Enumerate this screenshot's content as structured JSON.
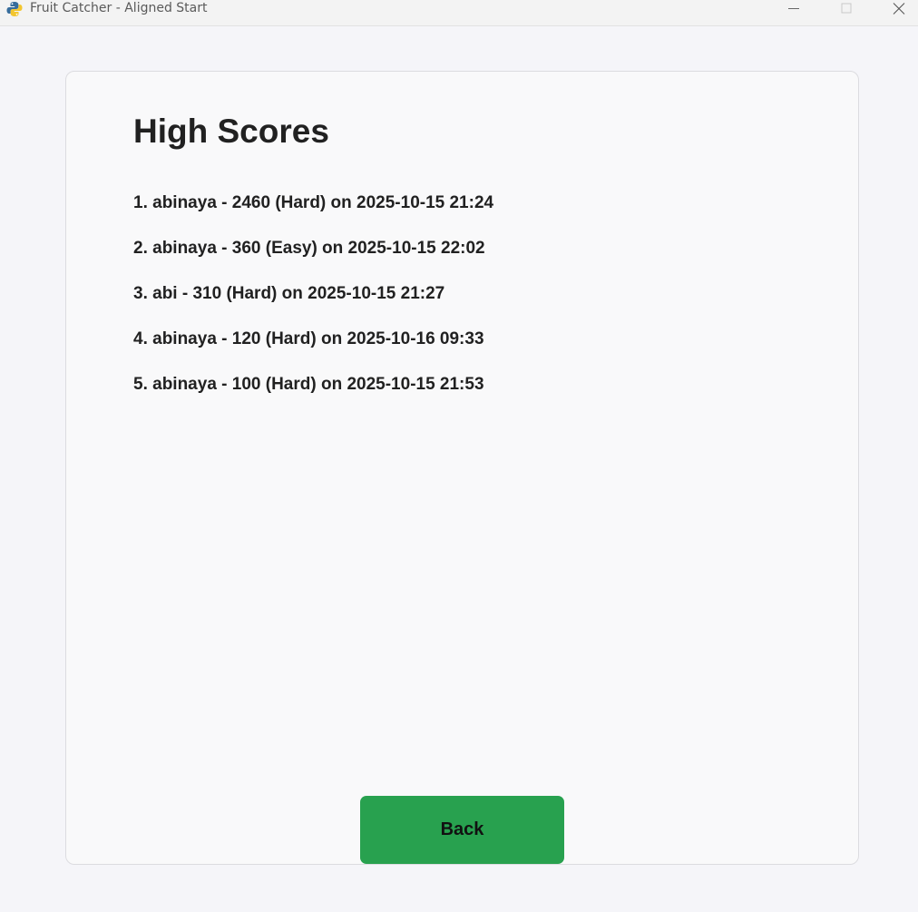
{
  "window": {
    "title": "Fruit Catcher - Aligned Start",
    "icon": "python-snake-icon"
  },
  "colors": {
    "card_background": "#f9f9fa",
    "page_background": "#f5f5f9",
    "back_button": "#28a14f",
    "text": "#212121"
  },
  "high_scores": {
    "title": "High Scores",
    "entries": [
      "1. abinaya - 2460 (Hard) on 2025-10-15 21:24",
      "2. abinaya - 360 (Easy) on 2025-10-15 22:02",
      "3. abi - 310 (Hard) on 2025-10-15 21:27",
      "4. abinaya - 120 (Hard) on 2025-10-16 09:33",
      "5. abinaya - 100 (Hard) on 2025-10-15 21:53"
    ],
    "back_label": "Back"
  }
}
